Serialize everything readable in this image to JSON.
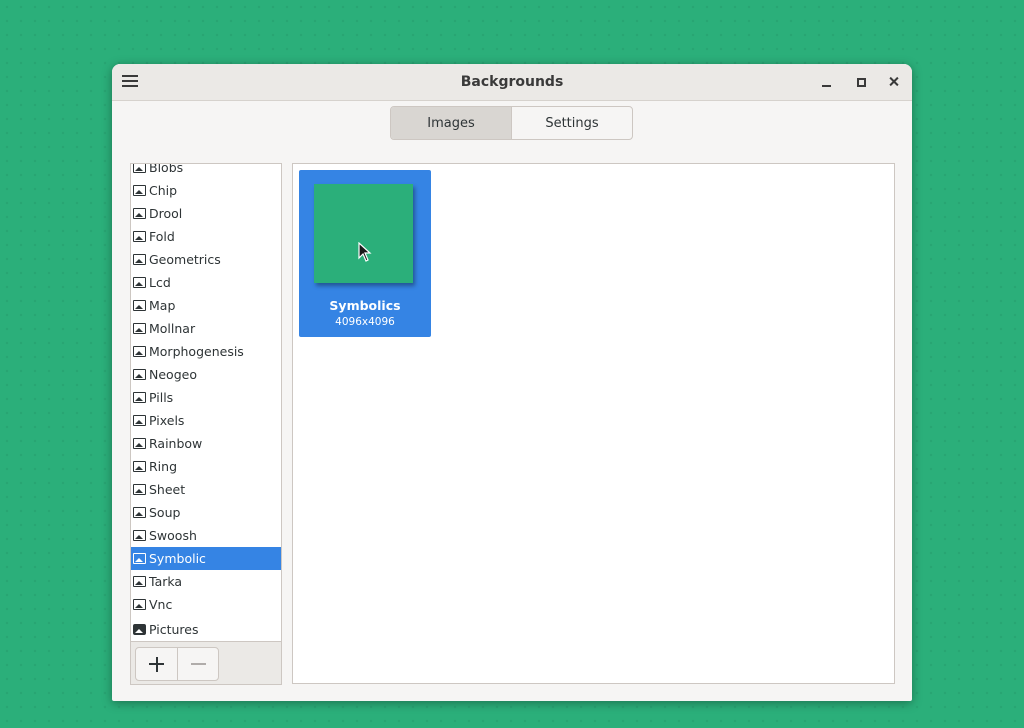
{
  "window": {
    "title": "Backgrounds"
  },
  "tabs": [
    {
      "label": "Images",
      "active": true
    },
    {
      "label": "Settings",
      "active": false
    }
  ],
  "sidebar": {
    "items": [
      {
        "label": "Blobs"
      },
      {
        "label": "Chip"
      },
      {
        "label": "Drool"
      },
      {
        "label": "Fold"
      },
      {
        "label": "Geometrics"
      },
      {
        "label": "Lcd"
      },
      {
        "label": "Map"
      },
      {
        "label": "Mollnar"
      },
      {
        "label": "Morphogenesis"
      },
      {
        "label": "Neogeo"
      },
      {
        "label": "Pills"
      },
      {
        "label": "Pixels"
      },
      {
        "label": "Rainbow"
      },
      {
        "label": "Ring"
      },
      {
        "label": "Sheet"
      },
      {
        "label": "Soup"
      },
      {
        "label": "Swoosh"
      },
      {
        "label": "Symbolic",
        "selected": true
      },
      {
        "label": "Tarka"
      },
      {
        "label": "Vnc"
      },
      {
        "label": "Pictures",
        "icon": "folder-icon"
      }
    ],
    "toolbar": {
      "add_icon": "plus-icon",
      "remove_icon": "minus-icon"
    }
  },
  "grid": {
    "items": [
      {
        "name": "Symbolics",
        "size": "4096x4096",
        "color": "#2baf7a",
        "selected": true
      }
    ]
  },
  "colors": {
    "desktop": "#2baf7a",
    "accent": "#3584e4"
  }
}
